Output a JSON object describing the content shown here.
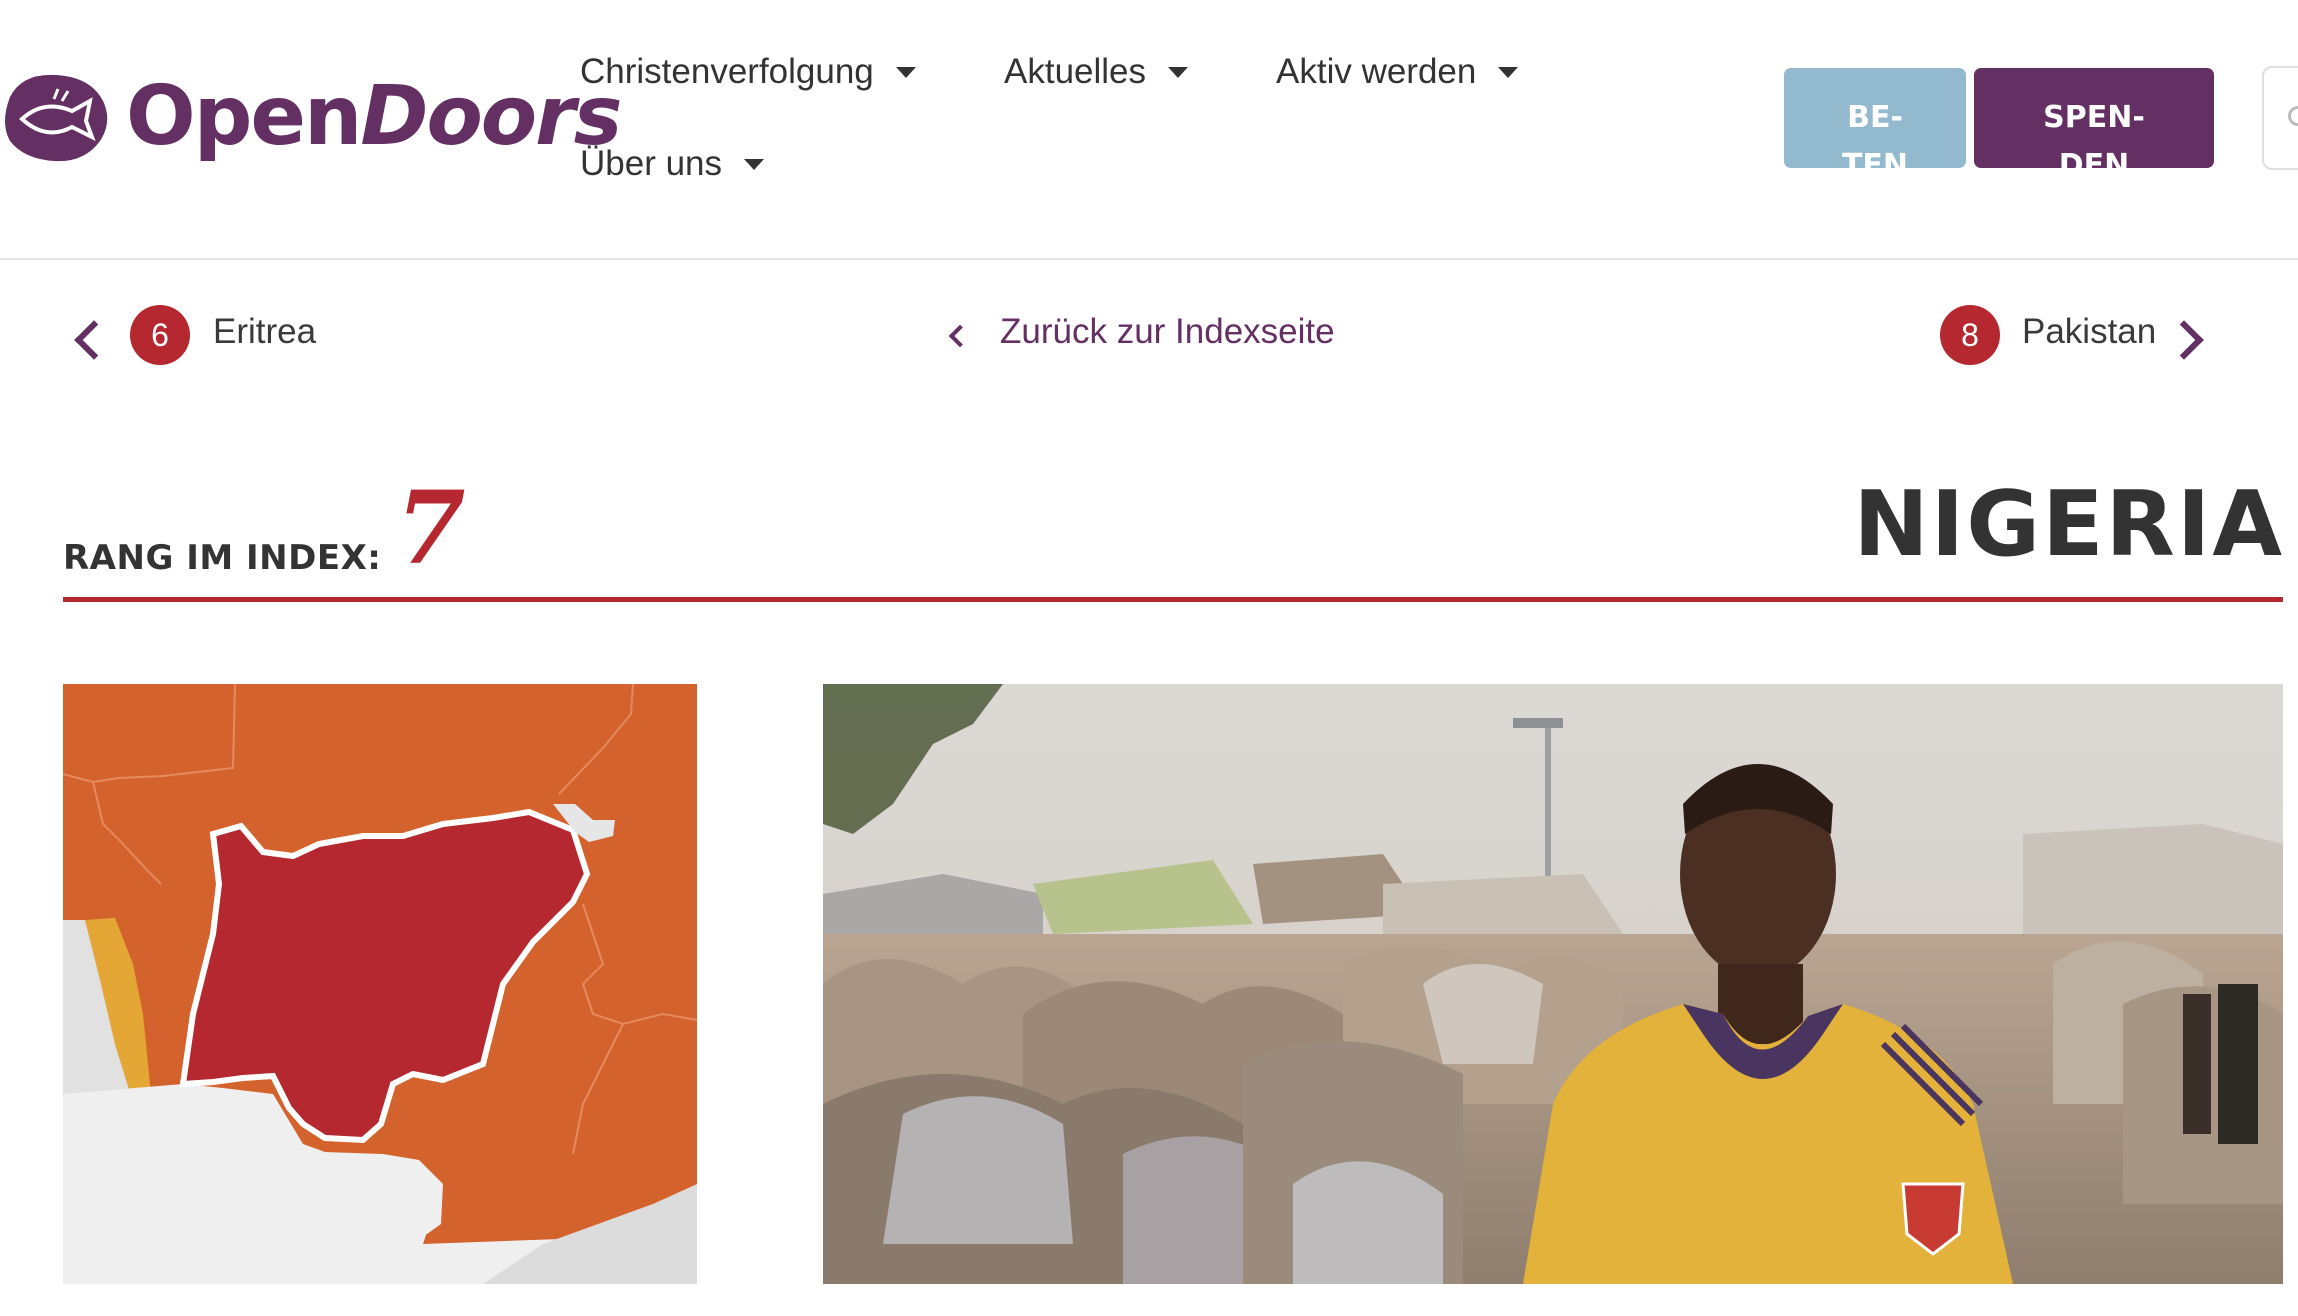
{
  "header": {
    "logo": {
      "word1": "Open",
      "word2": "Doors"
    },
    "nav": [
      "Christenverfolgung",
      "Aktuelles",
      "Aktiv werden",
      "Über uns"
    ],
    "pray_button": "BE-\nTEN",
    "donate_button": "SPEN-\nDEN"
  },
  "pager": {
    "prev_rank": "6",
    "prev_country": "Eritrea",
    "back_label": "Zurück zur Indexseite",
    "next_rank": "8",
    "next_country": "Pakistan"
  },
  "country_page": {
    "rank_label": "RANG IM INDEX:",
    "rank": "7",
    "country": "NIGERIA"
  },
  "colors": {
    "brand_purple": "#642f63",
    "accent_red": "#b5282f",
    "pray_blue": "#93b9ce",
    "map_orange": "#d4622c",
    "map_yellow": "#e4a735",
    "map_gray": "#e6e6e6"
  },
  "icons": [
    "fish-logo-icon",
    "chevron-left-icon",
    "chevron-right-icon",
    "caret-down-icon",
    "search-icon"
  ]
}
